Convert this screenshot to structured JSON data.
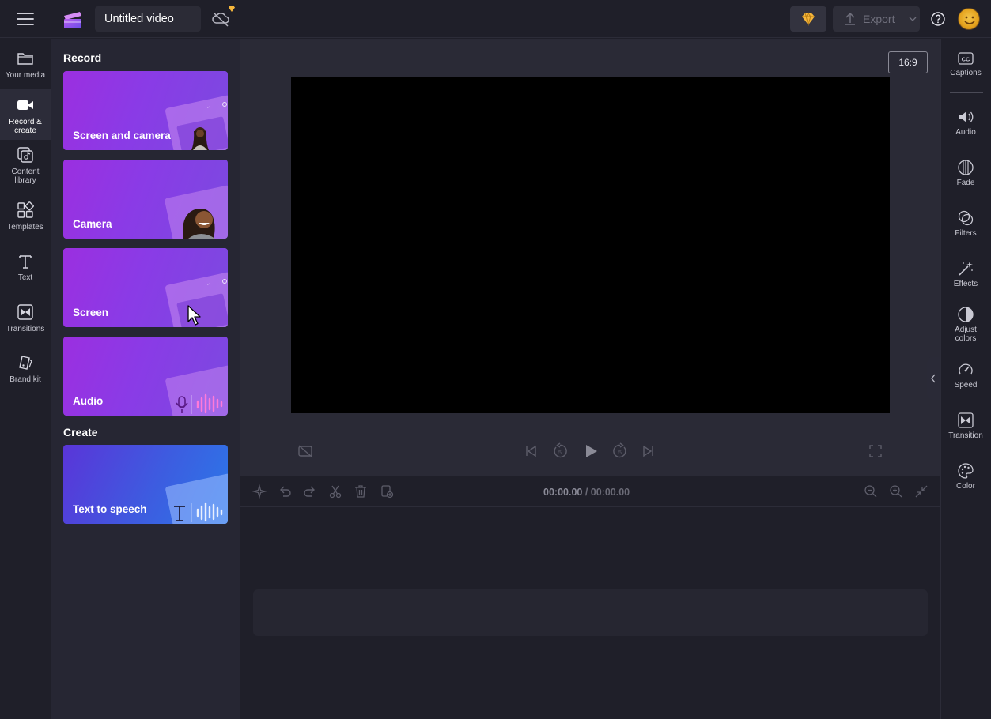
{
  "header": {
    "title": "Untitled video",
    "export_label": "Export",
    "icons": [
      "menu-icon",
      "clipchamp-logo",
      "cloud-off-icon",
      "premium-gem-icon",
      "upload-icon",
      "help-icon",
      "user-avatar"
    ]
  },
  "left_nav": {
    "items": [
      {
        "label": "Your media",
        "icon": "folder-icon"
      },
      {
        "label": "Record & create",
        "icon": "camera-icon",
        "active": true
      },
      {
        "label": "Content library",
        "icon": "content-library-icon"
      },
      {
        "label": "Templates",
        "icon": "templates-icon"
      },
      {
        "label": "Text",
        "icon": "text-icon"
      },
      {
        "label": "Transitions",
        "icon": "transitions-icon"
      },
      {
        "label": "Brand kit",
        "icon": "brand-kit-icon"
      }
    ]
  },
  "panel": {
    "record_heading": "Record",
    "create_heading": "Create",
    "cards": [
      {
        "label": "Screen and camera"
      },
      {
        "label": "Camera"
      },
      {
        "label": "Screen"
      },
      {
        "label": "Audio"
      },
      {
        "label": "Text to speech"
      }
    ]
  },
  "stage": {
    "aspect_ratio": "16:9"
  },
  "timeline": {
    "current_time": "00:00.00",
    "total_time": "/ 00:00.00"
  },
  "right_rail": {
    "items": [
      {
        "label": "Captions",
        "icon": "captions-icon"
      },
      {
        "label": "Audio",
        "icon": "speaker-icon"
      },
      {
        "label": "Fade",
        "icon": "fade-icon"
      },
      {
        "label": "Filters",
        "icon": "filters-icon"
      },
      {
        "label": "Effects",
        "icon": "magic-wand-icon"
      },
      {
        "label": "Adjust colors",
        "icon": "adjust-colors-icon"
      },
      {
        "label": "Speed",
        "icon": "speed-icon"
      },
      {
        "label": "Transition",
        "icon": "transition-icon"
      },
      {
        "label": "Color",
        "icon": "palette-icon"
      }
    ]
  },
  "colors": {
    "background": "#1f1f29",
    "panel": "#262633",
    "stage": "#2a2a36",
    "card_purple": "#8a3be6",
    "card_blue": "#3d5ce0",
    "premium_gold": "#f6b73c"
  }
}
